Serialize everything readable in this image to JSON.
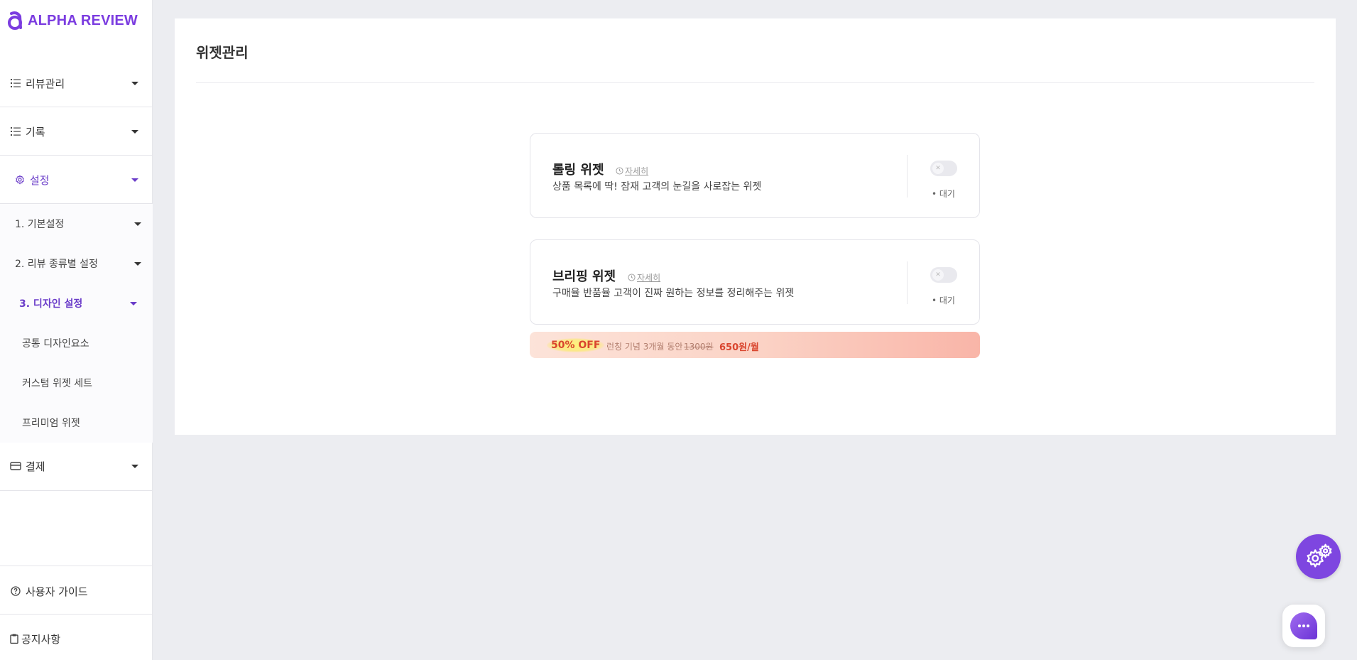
{
  "brand": {
    "name": "ALPHA REVIEW",
    "color": "#7b3ce0"
  },
  "sidebar": {
    "menu": [
      {
        "label": "리뷰관리",
        "icon": "list-icon"
      },
      {
        "label": "기록",
        "icon": "list-icon"
      },
      {
        "label": "설정",
        "icon": "gear-icon",
        "active": true
      },
      {
        "label": "결제",
        "icon": "card-icon"
      }
    ],
    "settings_sub": [
      {
        "label": "1. 기본설정"
      },
      {
        "label": "2. 리뷰 종류별 설정"
      },
      {
        "label": "3. 디자인 설정",
        "active": true
      }
    ],
    "design_sub": [
      {
        "label": "공통 디자인요소"
      },
      {
        "label": "커스텀 위젯 세트"
      },
      {
        "label": "프리미엄 위젯"
      }
    ],
    "footer": [
      {
        "label": "사용자 가이드",
        "icon": "help-circle-icon"
      },
      {
        "label": "공지사항",
        "icon": "clipboard-icon"
      }
    ]
  },
  "main": {
    "title": "위젯관리",
    "widgets": [
      {
        "title": "롤링 위젯",
        "detail": "자세히",
        "description": "상품 목록에 딱! 잠재 고객의 눈길을 사로잡는 위젯",
        "status": "• 대기",
        "enabled": false
      },
      {
        "title": "브리핑 위젯",
        "detail": "자세히",
        "description": "구매율 반품율 고객이 진짜 원하는 정보를 정리해주는 위젯",
        "status": "• 대기",
        "enabled": false
      }
    ],
    "promo": {
      "badge": "50% OFF",
      "text": "런칭 기념 3개월 동안",
      "old_price": "1300원",
      "new_price": "650원/월"
    }
  },
  "colors": {
    "accent": "#6a3cc9",
    "promo_red": "#d9452e"
  }
}
